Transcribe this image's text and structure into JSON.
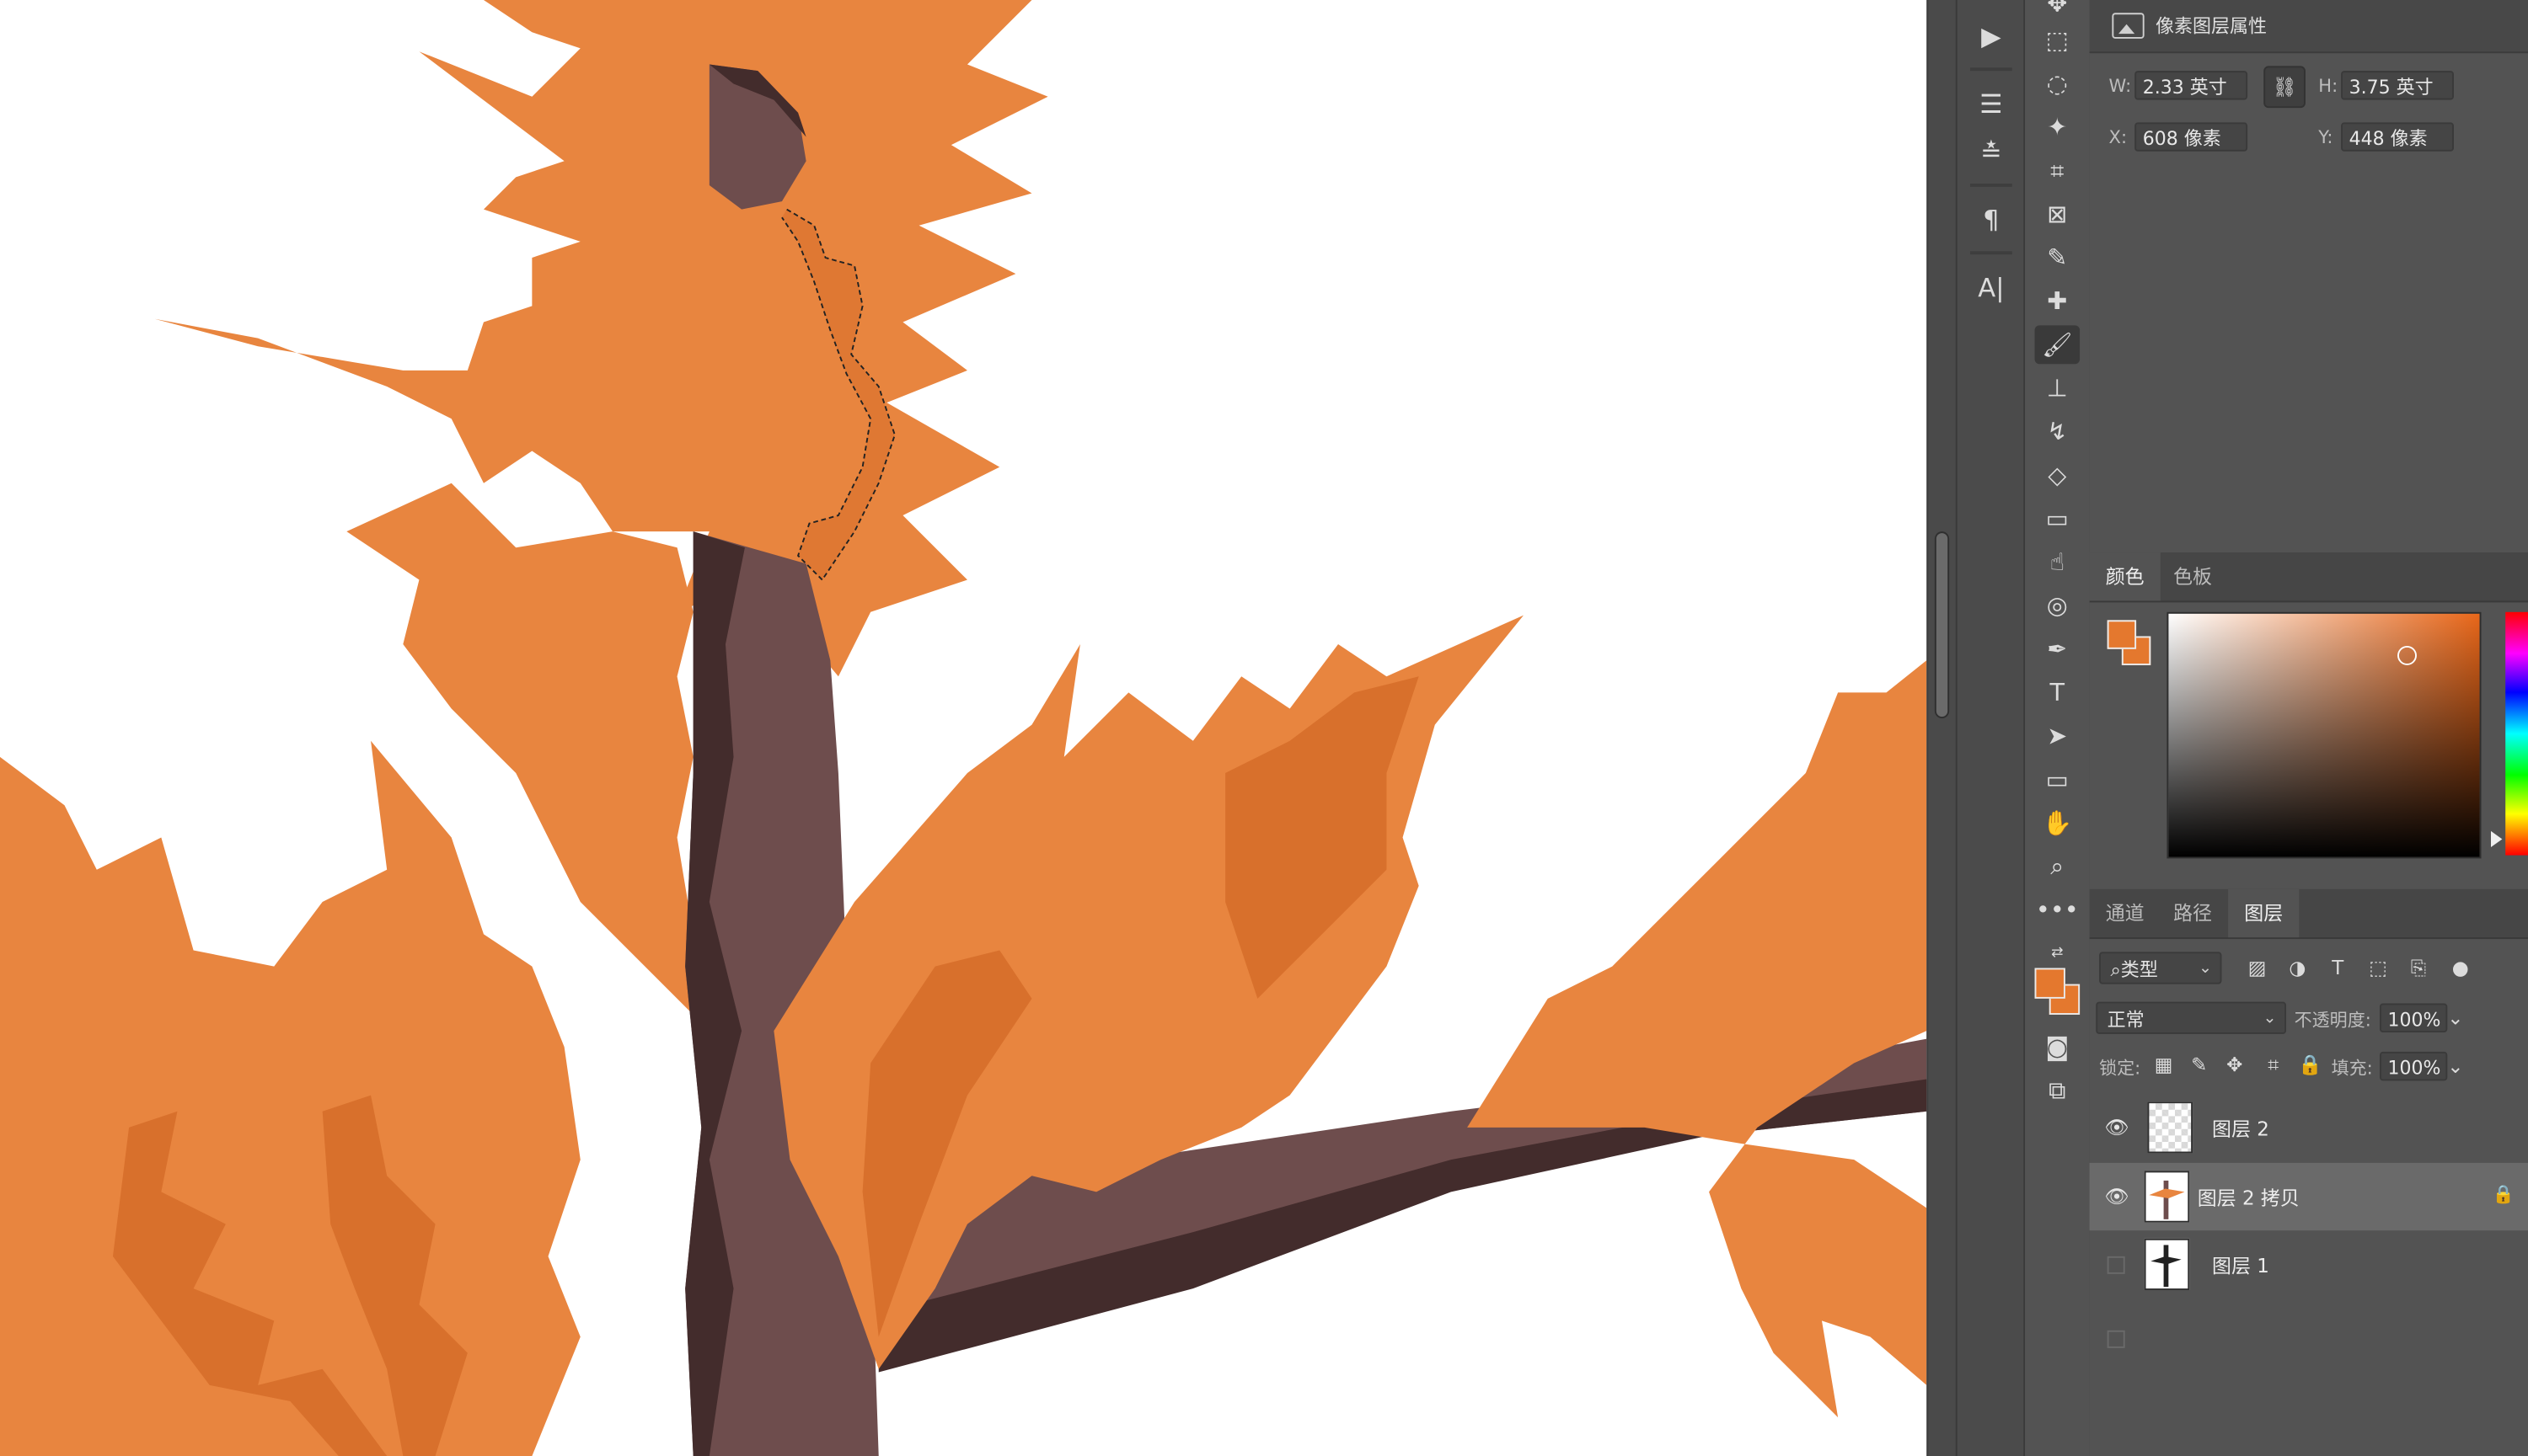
{
  "properties": {
    "title": "像素图层属性",
    "w_label": "W:",
    "w_value": "2.33 英寸",
    "h_label": "H:",
    "h_value": "3.75 英寸",
    "x_label": "X:",
    "x_value": "608 像素",
    "y_label": "Y:",
    "y_value": "448 像素"
  },
  "color_panel": {
    "tabs": [
      "颜色",
      "色板"
    ],
    "foreground": "#e4782e",
    "background": "#e4782e"
  },
  "layers_panel": {
    "tabs": [
      "通道",
      "路径",
      "图层"
    ],
    "filter_label": "类型",
    "blend_mode": "正常",
    "opacity_label": "不透明度:",
    "opacity_value": "100%",
    "lock_label": "锁定:",
    "fill_label": "填充:",
    "fill_value": "100%",
    "layers": [
      {
        "name": "图层 2",
        "visible": true,
        "selected": false,
        "locked": false
      },
      {
        "name": "图层 2 拷贝",
        "visible": true,
        "selected": true,
        "locked": true
      },
      {
        "name": "图层 1",
        "visible": false,
        "selected": false,
        "locked": false
      }
    ]
  },
  "colors": {
    "leaf": "#e8853f",
    "leaf_shadow": "#d8702c",
    "trunk": "#6e4d4d",
    "trunk_shadow": "#432c2c"
  }
}
